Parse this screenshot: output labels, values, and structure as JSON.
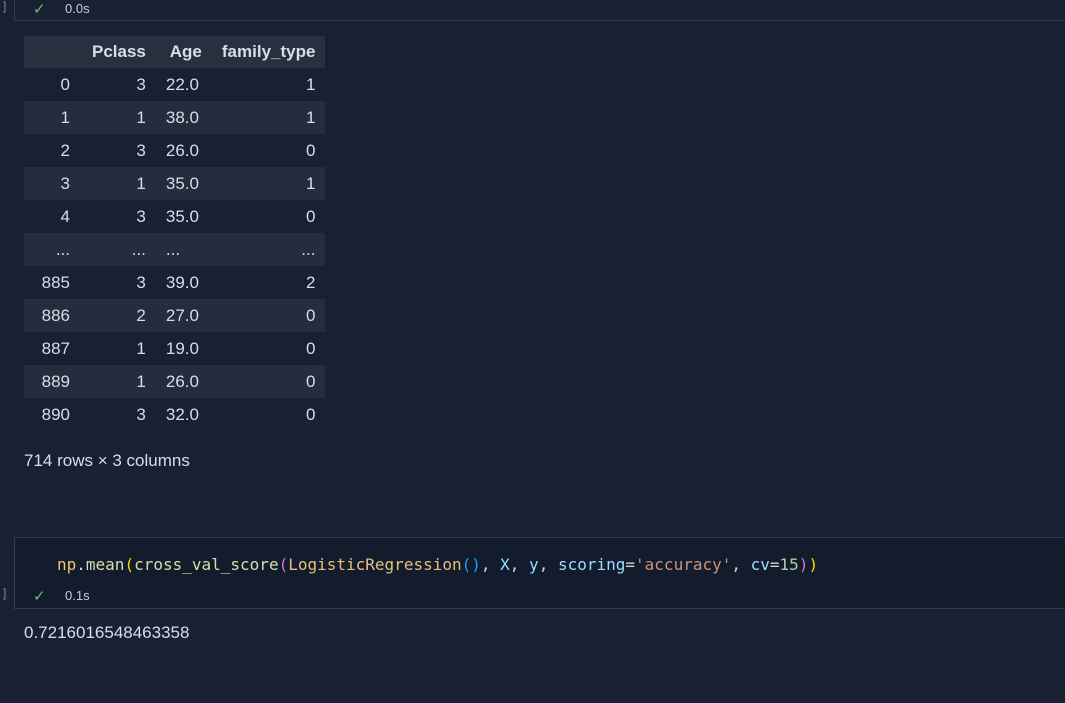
{
  "cell1": {
    "status": "0.0s",
    "dataframe": {
      "columns": [
        "",
        "Pclass",
        "Age",
        "family_type"
      ],
      "rows": [
        {
          "index": "0",
          "pclass": "3",
          "age": "22.0",
          "family_type": "1"
        },
        {
          "index": "1",
          "pclass": "1",
          "age": "38.0",
          "family_type": "1"
        },
        {
          "index": "2",
          "pclass": "3",
          "age": "26.0",
          "family_type": "0"
        },
        {
          "index": "3",
          "pclass": "1",
          "age": "35.0",
          "family_type": "1"
        },
        {
          "index": "4",
          "pclass": "3",
          "age": "35.0",
          "family_type": "0"
        },
        {
          "index": "...",
          "pclass": "...",
          "age": "...",
          "family_type": "..."
        },
        {
          "index": "885",
          "pclass": "3",
          "age": "39.0",
          "family_type": "2"
        },
        {
          "index": "886",
          "pclass": "2",
          "age": "27.0",
          "family_type": "0"
        },
        {
          "index": "887",
          "pclass": "1",
          "age": "19.0",
          "family_type": "0"
        },
        {
          "index": "889",
          "pclass": "1",
          "age": "26.0",
          "family_type": "0"
        },
        {
          "index": "890",
          "pclass": "3",
          "age": "32.0",
          "family_type": "0"
        }
      ],
      "shape_text": "714 rows × 3 columns"
    }
  },
  "cell2": {
    "code": {
      "np": "np",
      "dot": ".",
      "mean": "mean",
      "p1o": "(",
      "cvs": "cross_val_score",
      "p2o": "(",
      "lr": "LogisticRegression",
      "p3": "()",
      "c1": ", ",
      "x": "X",
      "c2": ", ",
      "y": "y",
      "c3": ", ",
      "scoring": "scoring",
      "eq1": "=",
      "str": "'accuracy'",
      "c4": ", ",
      "cv": "cv",
      "eq2": "=",
      "num": "15",
      "p2c": ")",
      "p1c": ")"
    },
    "status": "0.1s",
    "output": "0.7216016548463358"
  },
  "icons": {
    "check": "✓",
    "bracket": "]"
  },
  "colors": {
    "background": "#182134",
    "success": "#6fbf73",
    "string": "#ce9178",
    "function": "#dcdcaa"
  }
}
